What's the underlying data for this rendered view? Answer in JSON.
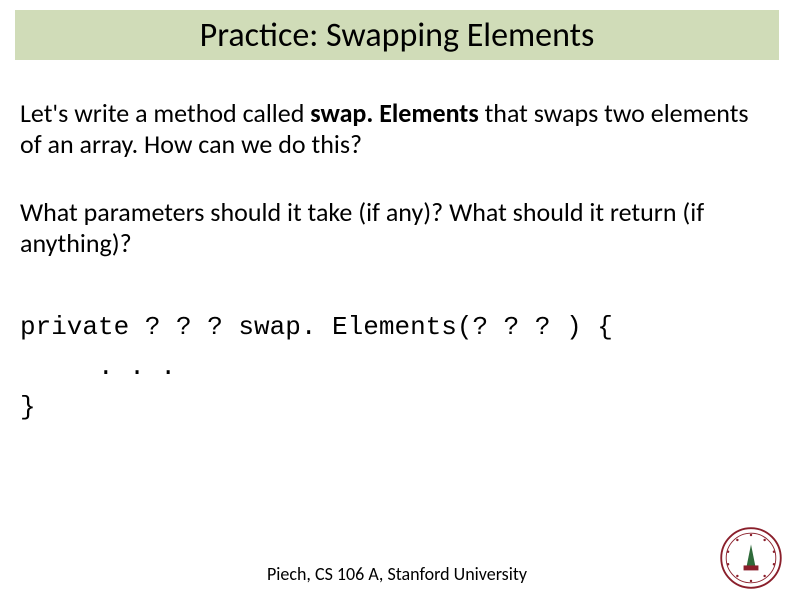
{
  "title": "Practice: Swapping Elements",
  "para1_pre": "Let's write a method called ",
  "para1_bold": "swap. Elements ",
  "para1_post": "that swaps two elements of an array.  How can we do this?",
  "para2": "What parameters should it take (if any)?  What should it return (if anything)?",
  "code_line1": "private ? ? ? swap. Elements(? ? ? ) {",
  "code_line2": "     . . .",
  "code_line3": "}",
  "footer": "Piech, CS 106 A, Stanford University",
  "seal_color_outer": "#8a1f2b",
  "seal_color_inner": "#b8384a"
}
